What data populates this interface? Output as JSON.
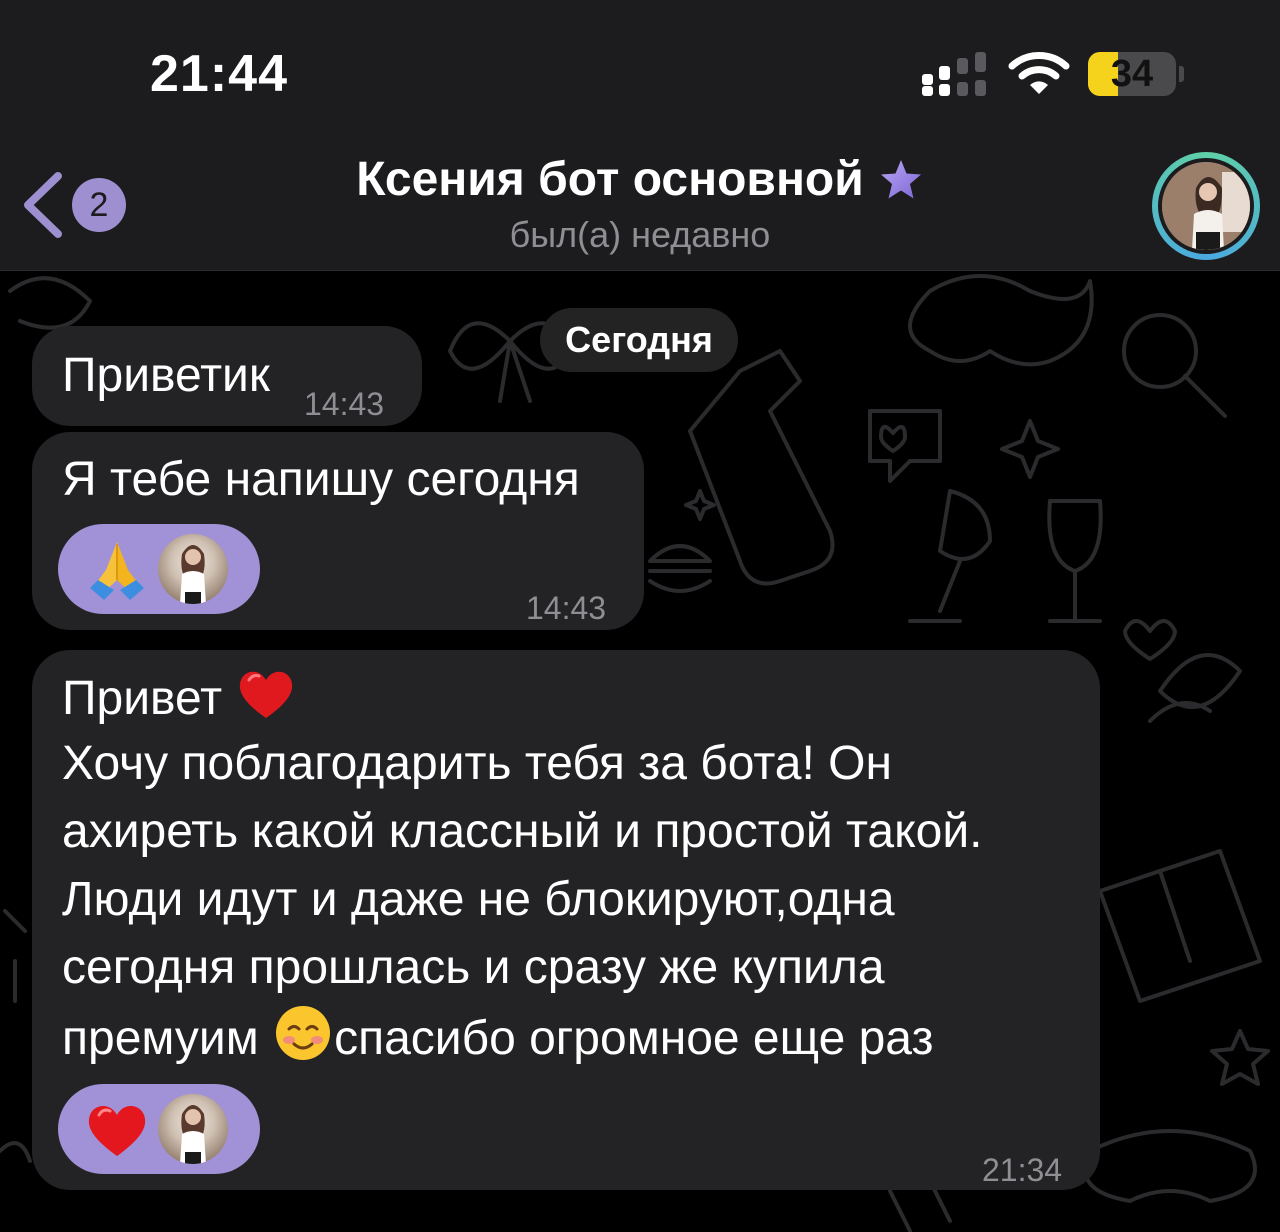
{
  "status_bar": {
    "time": "21:44",
    "battery": "34",
    "battery_fraction": 0.34
  },
  "header": {
    "back_badge": "2",
    "title": "Ксения бот основной",
    "subtitle": "был(а) недавно"
  },
  "date_divider": "Сегодня",
  "messages": [
    {
      "text": "Приветик",
      "time": "14:43"
    },
    {
      "text": "Я тебе напишу сегодня",
      "time": "14:43",
      "reaction": "folded-hands"
    },
    {
      "lines": [
        "Привет",
        "Хочу поблагодарить тебя за бота! Он",
        "ахиреть какой классный и простой такой.",
        "Люди идут и даже не блокируют,одна",
        "сегодня прошлась и сразу же купила",
        "премуим",
        "спасибо огромное еще раз"
      ],
      "time": "21:34",
      "reaction": "red-heart"
    }
  ],
  "colors": {
    "header_bg": "#1c1c1e",
    "bubble_bg": "#232325",
    "accent": "#9d8fd0",
    "reaction_bg": "#a191d6",
    "time_text": "#8e8e93"
  }
}
